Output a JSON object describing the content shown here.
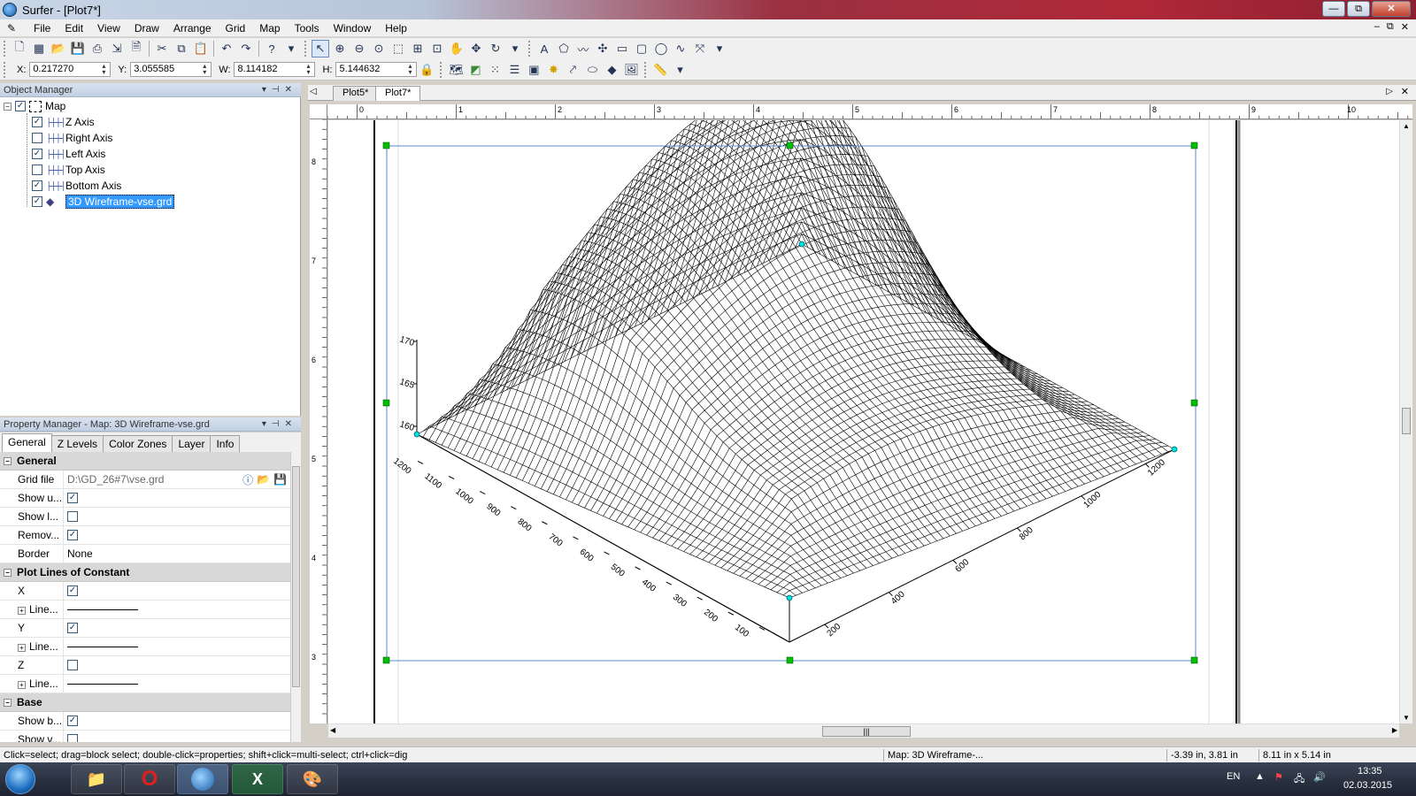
{
  "window": {
    "title": "Surfer - [Plot7*]",
    "minimize": "—",
    "maximize": "⧉",
    "close": "✕"
  },
  "menu": {
    "items": [
      "File",
      "Edit",
      "View",
      "Draw",
      "Arrange",
      "Grid",
      "Map",
      "Tools",
      "Window",
      "Help"
    ],
    "mdi_minimize": "–",
    "mdi_restore": "⧉",
    "mdi_close": "✕"
  },
  "coords": {
    "x_label": "X:",
    "x_value": "0.217270",
    "y_label": "Y:",
    "y_value": "3.055585",
    "w_label": "W:",
    "w_value": "8.114182",
    "h_label": "H:",
    "h_value": "5.144632"
  },
  "object_manager": {
    "title": "Object Manager",
    "root": "Map",
    "items": [
      {
        "label": "Z Axis",
        "checked": true
      },
      {
        "label": "Right Axis",
        "checked": false
      },
      {
        "label": "Left Axis",
        "checked": true
      },
      {
        "label": "Top Axis",
        "checked": false
      },
      {
        "label": "Bottom Axis",
        "checked": true
      },
      {
        "label": "3D Wireframe-vse.grd",
        "checked": true,
        "selected": true
      }
    ]
  },
  "property_manager": {
    "title": "Property Manager - Map: 3D Wireframe-vse.grd",
    "tabs": [
      "General",
      "Z Levels",
      "Color Zones",
      "Layer",
      "Info"
    ],
    "active_tab": "General",
    "sections": {
      "general": "General",
      "plot_lines": "Plot Lines of Constant",
      "base": "Base"
    },
    "rows": {
      "grid_file_label": "Grid file",
      "grid_file_value": "D:\\GD_26#7\\vse.grd",
      "show_u_label": "Show u...",
      "show_l_label": "Show l...",
      "remove_label": "Remov...",
      "border_label": "Border",
      "border_value": "None",
      "x_label": "X",
      "line_label": "Line...",
      "y_label": "Y",
      "z_label": "Z",
      "show_b_label": "Show b...",
      "show_v_label": "Show v..."
    }
  },
  "documents": {
    "tabs": [
      "Plot5*",
      "Plot7*"
    ],
    "active": "Plot7*"
  },
  "rulers": {
    "top_labels": [
      "0",
      "1",
      "2",
      "3",
      "4",
      "5",
      "6",
      "7",
      "8",
      "9",
      "10"
    ],
    "left_labels": [
      "8",
      "7",
      "6",
      "5",
      "4",
      "3"
    ]
  },
  "plot": {
    "z_ticks": [
      "170",
      "165",
      "160"
    ],
    "left_ticks": [
      "1200",
      "1100",
      "1000",
      "900",
      "800",
      "700",
      "600",
      "500",
      "400",
      "300",
      "200",
      "100"
    ],
    "right_ticks": [
      "200",
      "400",
      "600",
      "800",
      "1000",
      "1200"
    ]
  },
  "status": {
    "hint": "Click=select; drag=block select; double-click=properties; shift+click=multi-select; ctrl+click=dig",
    "selection": "Map: 3D Wireframe-...",
    "cursor": "-3.39 in, 3.81 in",
    "size": "8.11 in x 5.14 in"
  },
  "taskbar": {
    "lang": "EN",
    "time": "13:35",
    "date": "02.03.2015"
  },
  "colors": {
    "accent": "#3399ff",
    "handle_green": "#00c000",
    "handle_cyan": "#00e0e0",
    "selection_blue": "#5a8ad8"
  }
}
